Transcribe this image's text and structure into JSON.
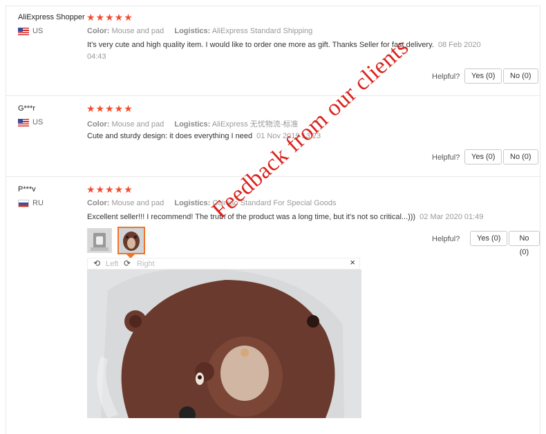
{
  "reviews": [
    {
      "user": "AliExpress Shopper",
      "country": "US",
      "stars": "★★★★★",
      "color_label": "Color:",
      "color_value": "Mouse and pad",
      "logistics_label": "Logistics:",
      "logistics_value": "AliExpress Standard Shipping",
      "text": "It's very cute and high quality item. I would like to order one more as gift. Thanks Seller for fast delivery.",
      "date": "08 Feb 2020 04:43",
      "helpful_label": "Helpful?",
      "yes_label": "Yes (0)",
      "no_label": "No (0)"
    },
    {
      "user": "G***r",
      "country": "US",
      "stars": "★★★★★",
      "color_label": "Color:",
      "color_value": "Mouse and pad",
      "logistics_label": "Logistics:",
      "logistics_value": "AliExpress 无忧物流-标准",
      "text": "Cute and sturdy design: it does everything I need",
      "date": "01 Nov 2019 13:23",
      "helpful_label": "Helpful?",
      "yes_label": "Yes (0)",
      "no_label": "No (0)"
    },
    {
      "user": "P***v",
      "country": "RU",
      "stars": "★★★★★",
      "color_label": "Color:",
      "color_value": "Mouse and pad",
      "logistics_label": "Logistics:",
      "logistics_value": "Cainiao Standard For Special Goods",
      "text": "Excellent seller!!! I recommend! The truth of the product was a long time, but it's not so critical...)))",
      "date": "02 Mar 2020 01:49",
      "helpful_label": "Helpful?",
      "yes_label": "Yes (0)",
      "no_label": "No (0)"
    }
  ],
  "viewer": {
    "left_label": "Left",
    "right_label": "Right",
    "close_label": "×",
    "rotate_left_icon": "rotate-left-icon",
    "rotate_right_icon": "rotate-right-icon"
  },
  "watermark": "Feedback from our clients",
  "colors": {
    "star": "#f34b2e",
    "thumb_selected": "#f57224",
    "watermark": "#d9251e"
  }
}
